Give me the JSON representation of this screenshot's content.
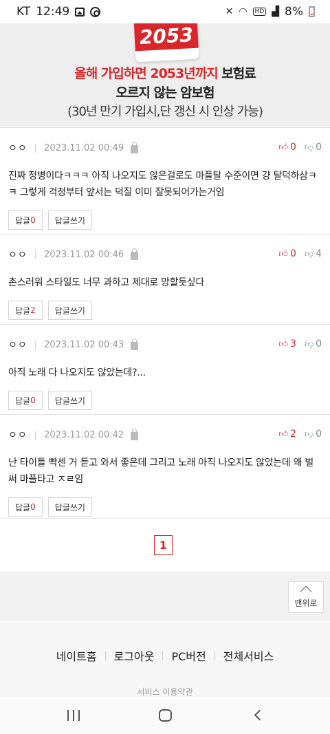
{
  "status_bar": {
    "carrier": "KT",
    "time": "12:49",
    "battery": "8%",
    "icons": [
      "gallery-icon",
      "swirl-icon",
      "mute-icon",
      "wifi-icon",
      "hd-icon",
      "signal-icon",
      "battery-icon"
    ]
  },
  "banner": {
    "year": "2053",
    "line1_red": "올해 가입하면 2053년까지",
    "line1_black": " 보험료",
    "line2": "오르지 않는 암보험",
    "line3": "(30년 만기 가입시,단 갱신 시 인상 가능)"
  },
  "comments": [
    {
      "author": "ㅇㅇ",
      "date": "2023.11.02 00:49",
      "likes": "0",
      "dislikes": "0",
      "text": "진짜 정병이다ㅋㅋㅋ 아직 나오지도 않은걸로도 마플탈 수준이면 걍 탈덕하삼ㅋㅋ 그렇게 걱정부터 앞서는 덕질 이미 잘못되어가는거임",
      "reply_label": "답글",
      "reply_count": "0",
      "write_reply_label": "답글쓰기"
    },
    {
      "author": "ㅇㅇ",
      "date": "2023.11.02 00:46",
      "likes": "0",
      "dislikes": "4",
      "text": "촌스러워 스타일도 너무 과하고 제대로 망할듯싶다",
      "reply_label": "답글",
      "reply_count": "2",
      "write_reply_label": "답글쓰기"
    },
    {
      "author": "ㅇㅇ",
      "date": "2023.11.02 00:43",
      "likes": "3",
      "dislikes": "0",
      "text": "아직 노래 다 나오지도 않았는데?...",
      "reply_label": "답글",
      "reply_count": "0",
      "write_reply_label": "답글쓰기"
    },
    {
      "author": "ㅇㅇ",
      "date": "2023.11.02 00:42",
      "likes": "2",
      "dislikes": "0",
      "text": "난 타이틀 빡센 거 듣고 와서 좋은데 그리고 노래 아직 나오지도 않았는데 왜 벌써 마플타고 ㅈㄹ임",
      "reply_label": "답글",
      "reply_count": "0",
      "write_reply_label": "답글쓰기"
    }
  ],
  "pagination": {
    "current_page": "1"
  },
  "top_button": {
    "label": "맨위로"
  },
  "footer": {
    "links": [
      "네이트홈",
      "로그아웃",
      "PC버전",
      "전체서비스"
    ],
    "terms": "서비스 이용약관"
  },
  "colors": {
    "accent": "#d8262b",
    "dislike": "#7a8a9a"
  }
}
